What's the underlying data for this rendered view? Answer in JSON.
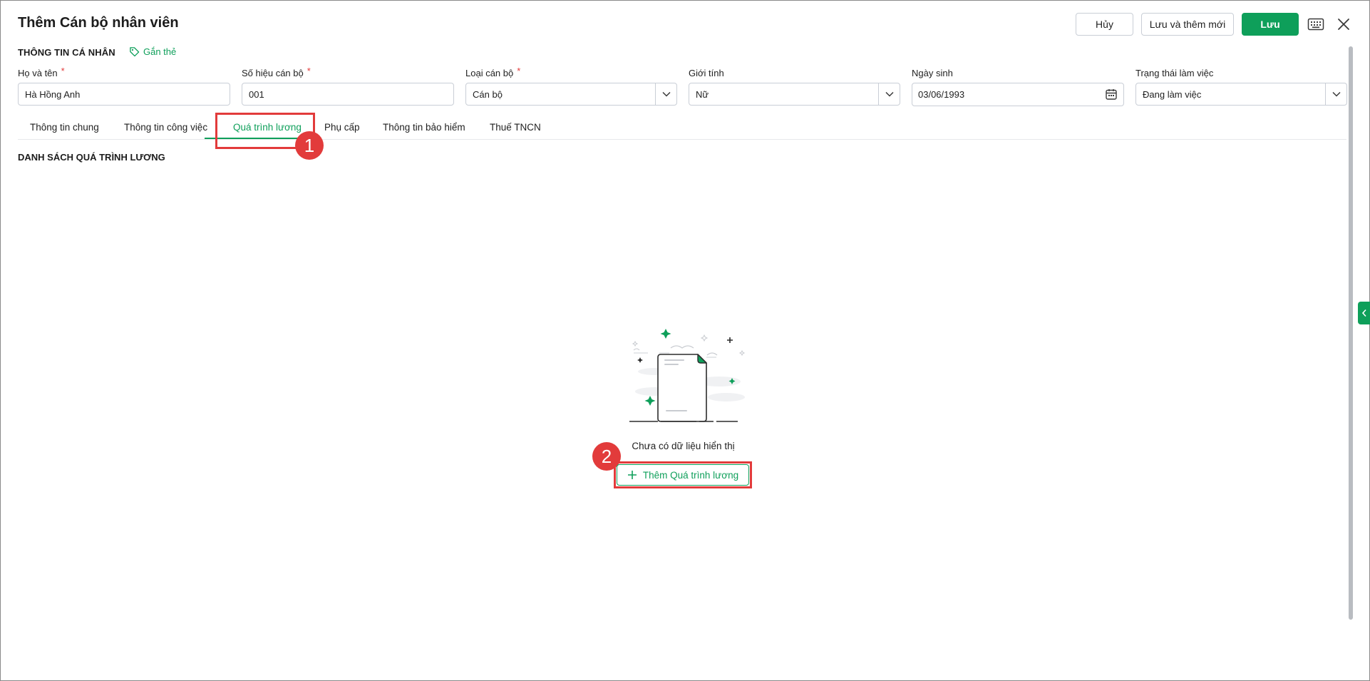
{
  "header": {
    "title": "Thêm Cán bộ nhân viên",
    "cancel_label": "Hủy",
    "save_new_label": "Lưu và thêm mới",
    "save_label": "Lưu"
  },
  "personal": {
    "section_title": "THÔNG TIN CÁ NHÂN",
    "tag_label": "Gắn thẻ",
    "required_mark": "*",
    "fields": {
      "name": {
        "label": "Họ và tên",
        "value": "Hà Hồng Anh"
      },
      "code": {
        "label": "Số hiệu cán bộ",
        "value": "001"
      },
      "type": {
        "label": "Loại cán bộ",
        "value": "Cán bộ"
      },
      "gender": {
        "label": "Giới tính",
        "value": "Nữ"
      },
      "dob": {
        "label": "Ngày sinh",
        "value": "03/06/1993"
      },
      "status": {
        "label": "Trạng thái làm việc",
        "value": "Đang làm việc"
      }
    }
  },
  "tabs": [
    {
      "label": "Thông tin chung"
    },
    {
      "label": "Thông tin công việc"
    },
    {
      "label": "Quá trình lương"
    },
    {
      "label": "Phụ cấp"
    },
    {
      "label": "Thông tin bảo hiểm"
    },
    {
      "label": "Thuế TNCN"
    }
  ],
  "active_tab": "Quá trình lương",
  "list": {
    "title": "DANH SÁCH QUÁ TRÌNH LƯƠNG",
    "empty_text": "Chưa có dữ liệu hiển thị",
    "add_label": "Thêm Quá trình lương"
  },
  "annotations": {
    "badge_1": "1",
    "badge_2": "2",
    "highlight_color": "#e23b3b"
  },
  "colors": {
    "accent": "#0e9f5a",
    "required": "#e23b3b"
  },
  "icons": {
    "tag": "tag-icon",
    "keyboard": "keyboard-icon",
    "close": "close-icon",
    "dropdown": "chevron-down-icon",
    "calendar": "calendar-icon",
    "add": "plus-icon",
    "side_toggle": "chevron-left-icon",
    "empty_state": "empty-document-illustration"
  }
}
